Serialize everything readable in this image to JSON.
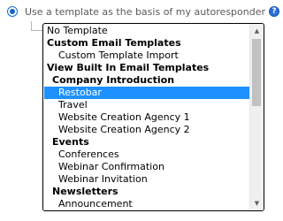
{
  "radio": {
    "label": "Use a template as the basis of my autoresponder",
    "selected": true,
    "help_glyph": "?"
  },
  "listbox": {
    "selected_value": "Restobar",
    "options": [
      {
        "label": "No Template",
        "kind": "item"
      },
      {
        "label": "Custom Email Templates",
        "kind": "group"
      },
      {
        "label": "Custom Template Import",
        "kind": "child"
      },
      {
        "label": "View Built In Email Templates",
        "kind": "group"
      },
      {
        "label": "Company Introduction",
        "kind": "subgroup"
      },
      {
        "label": "Restobar",
        "kind": "child",
        "selected": true
      },
      {
        "label": "Travel",
        "kind": "child"
      },
      {
        "label": "Website Creation Agency 1",
        "kind": "child"
      },
      {
        "label": "Website Creation Agency 2",
        "kind": "child"
      },
      {
        "label": "Events",
        "kind": "subgroup"
      },
      {
        "label": "Conferences",
        "kind": "child"
      },
      {
        "label": "Webinar Confirmation",
        "kind": "child"
      },
      {
        "label": "Webinar Invitation",
        "kind": "child"
      },
      {
        "label": "Newsletters",
        "kind": "subgroup"
      },
      {
        "label": "Announcement",
        "kind": "child"
      }
    ]
  },
  "icons": {
    "help": "help-icon",
    "scroll_up": "chevron-up-icon",
    "scroll_down": "chevron-down-icon"
  },
  "colors": {
    "selection": "#1e90ff",
    "radio_accent": "#1565c0",
    "help_icon": "#2a6fd6"
  }
}
